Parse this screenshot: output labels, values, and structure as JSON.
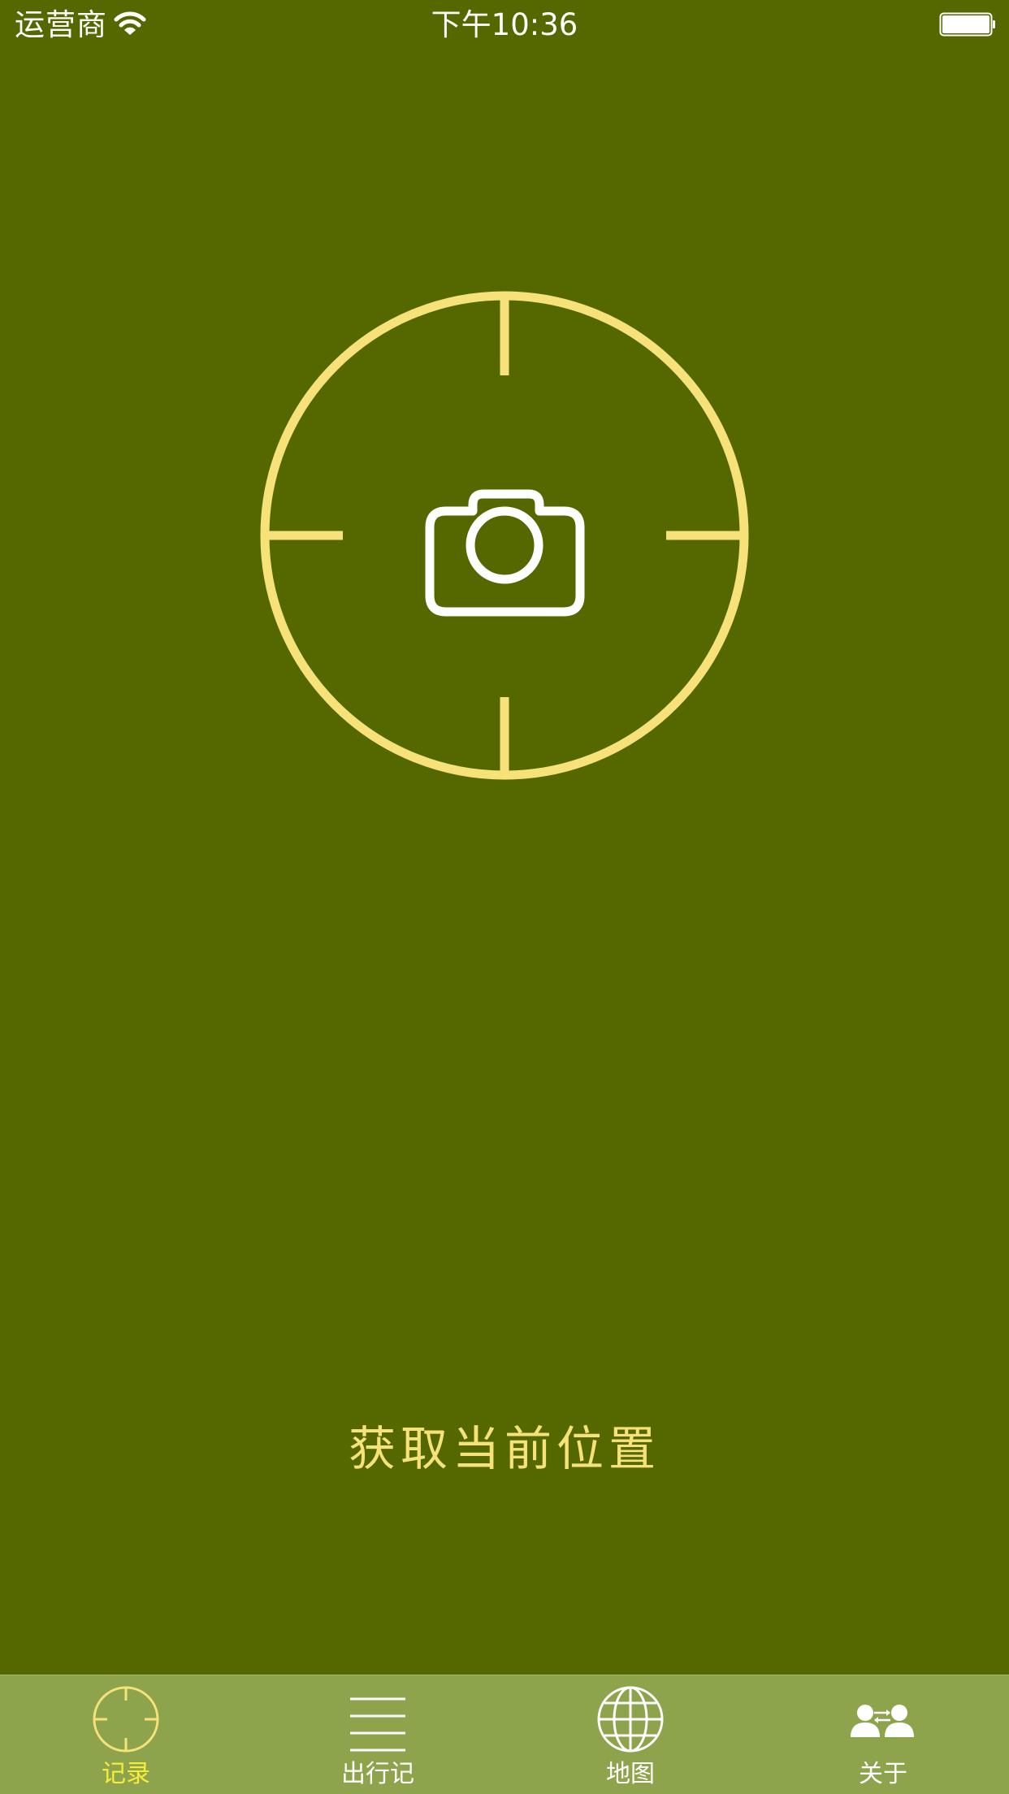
{
  "status_bar": {
    "carrier": "运营商",
    "time": "下午10:36",
    "wifi_icon": "wifi-icon",
    "battery_icon": "battery-icon"
  },
  "main": {
    "target_icon": "crosshair-camera-icon",
    "camera_icon": "camera-icon",
    "action_label": "获取当前位置"
  },
  "tab_bar": {
    "tabs": [
      {
        "label": "记录",
        "icon": "crosshair-icon",
        "active": true
      },
      {
        "label": "出行记",
        "icon": "list-icon",
        "active": false
      },
      {
        "label": "地图",
        "icon": "globe-icon",
        "active": false
      },
      {
        "label": "关于",
        "icon": "people-icon",
        "active": false
      }
    ]
  },
  "colors": {
    "background": "#556800",
    "accent": "#f7e27a",
    "tab_bar": "#8ea44c",
    "active_tab_label": "#f6ec3a",
    "foreground": "#ffffff"
  }
}
